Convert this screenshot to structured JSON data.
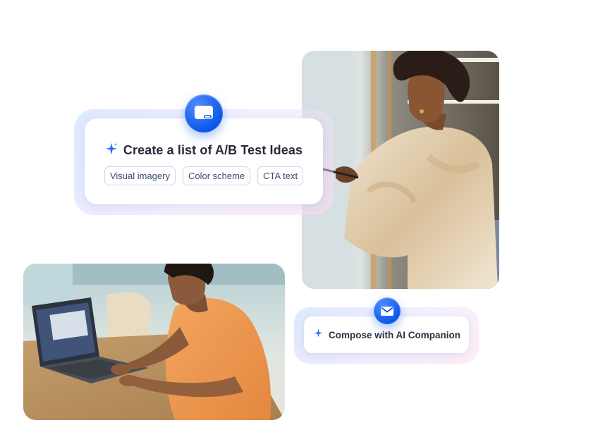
{
  "ab_card": {
    "title": "Create a list of A/B Test Ideas",
    "chips": [
      "Visual imagery",
      "Color scheme",
      "CTA text"
    ]
  },
  "compose_card": {
    "label": "Compose with AI Companion"
  },
  "icons": {
    "chat_app": "chat-bubble-icon",
    "mail_app": "envelope-icon",
    "sparkle": "sparkle-icon"
  },
  "colors": {
    "accent": "#0b5cff",
    "sparkle": "#2f6bff",
    "text": "#262b3a"
  }
}
